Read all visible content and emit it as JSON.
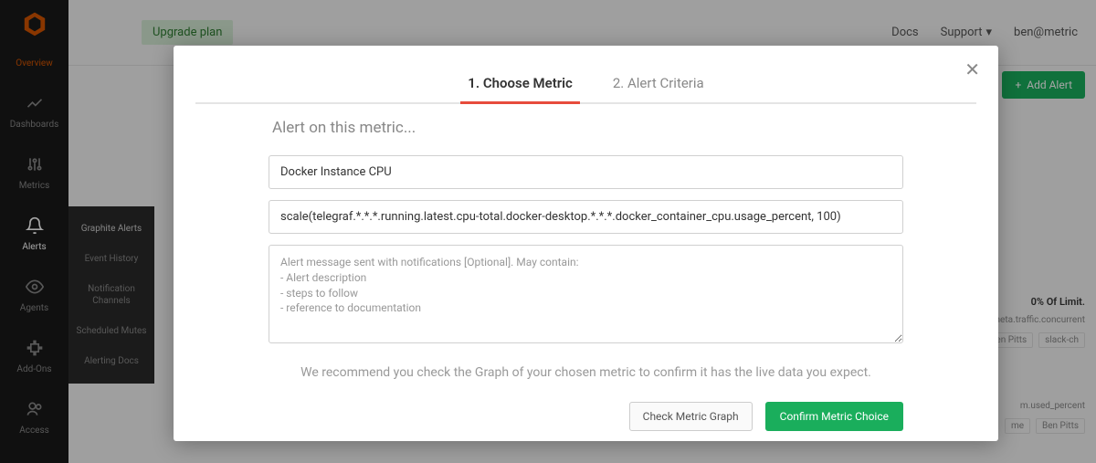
{
  "sidebar": {
    "items": [
      {
        "label": "Overview"
      },
      {
        "label": "Dashboards"
      },
      {
        "label": "Metrics"
      },
      {
        "label": "Alerts"
      },
      {
        "label": "Agents"
      },
      {
        "label": "Add-Ons"
      },
      {
        "label": "Access"
      }
    ]
  },
  "flyout": {
    "items": [
      {
        "label": "Graphite Alerts"
      },
      {
        "label": "Event History"
      },
      {
        "label": "Notification Channels"
      },
      {
        "label": "Scheduled Mutes"
      },
      {
        "label": "Alerting Docs"
      }
    ]
  },
  "topbar": {
    "upgrade": "Upgrade plan",
    "docs": "Docs",
    "support": "Support",
    "user": "ben@metric"
  },
  "page": {
    "add_alert": "Add Alert"
  },
  "modal": {
    "tabs": [
      {
        "label": "1. Choose Metric"
      },
      {
        "label": "2. Alert Criteria"
      }
    ],
    "subtitle": "Alert on this metric...",
    "inputs": {
      "name_value": "Docker Instance CPU",
      "query_value": "scale(telegraf.*.*.*.running.latest.cpu-total.docker-desktop.*.*.*.docker_container_cpu.usage_percent, 100)",
      "message_placeholder": "Alert message sent with notifications [Optional]. May contain:\n- Alert description\n- steps to follow\n- reference to documentation"
    },
    "hint": "We recommend you check the Graph of your chosen metric to confirm it has the live data you expect.",
    "actions": {
      "check": "Check Metric Graph",
      "confirm": "Confirm Metric Choice"
    }
  },
  "bg": {
    "limit": "0% Of Limit.",
    "meta_traffic": "meta.traffic.concurrent",
    "mem_used": "m.used_percent",
    "chips": {
      "me": "me",
      "ben": "Ben Pitts",
      "slack": "slack-ch"
    }
  }
}
